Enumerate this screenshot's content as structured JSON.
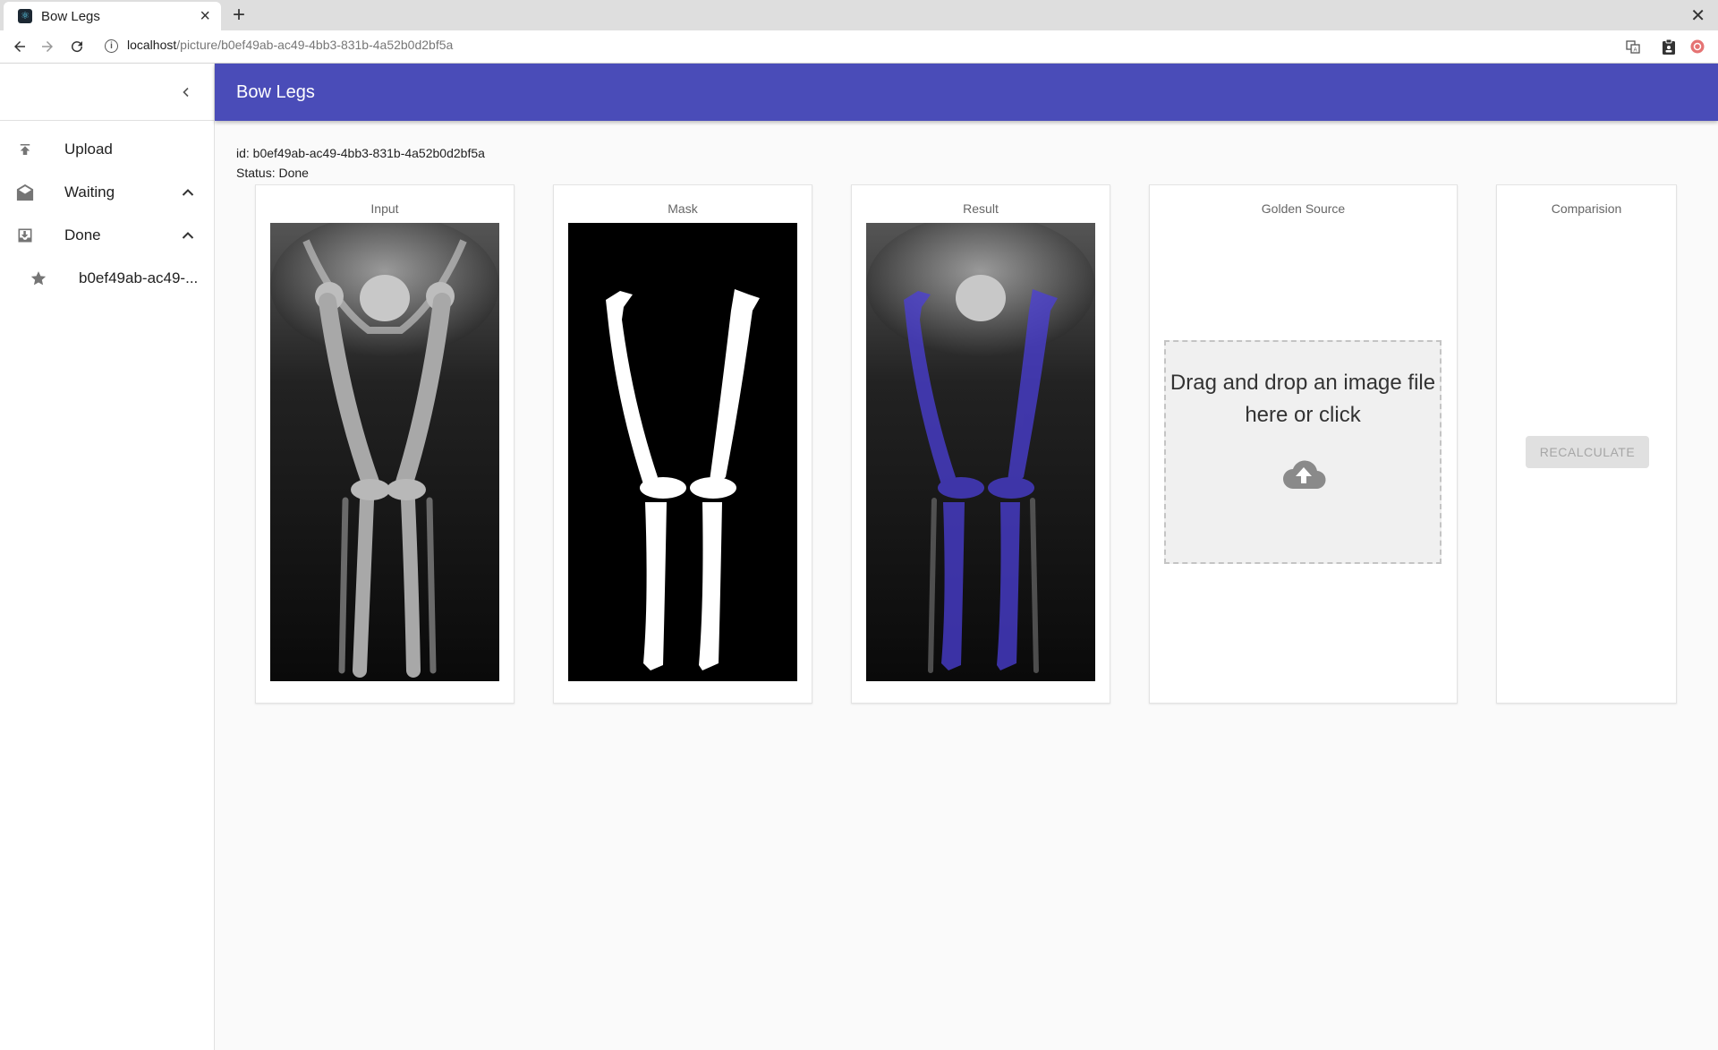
{
  "browser": {
    "tab_title": "Bow Legs",
    "url_host": "localhost",
    "url_path": "/picture/b0ef49ab-ac49-4bb3-831b-4a52b0d2bf5a"
  },
  "sidebar": {
    "items": [
      {
        "label": "Upload",
        "icon": "upload-icon"
      },
      {
        "label": "Waiting",
        "icon": "mail-open-icon",
        "expanded": true
      },
      {
        "label": "Done",
        "icon": "inbox-download-icon",
        "expanded": true
      },
      {
        "label": "b0ef49ab-ac49-...",
        "icon": "star-icon"
      }
    ]
  },
  "appbar": {
    "title": "Bow Legs"
  },
  "details": {
    "id_line": "id: b0ef49ab-ac49-4bb3-831b-4a52b0d2bf5a",
    "status_line": "Status: Done"
  },
  "cards": {
    "input": {
      "title": "Input"
    },
    "mask": {
      "title": "Mask"
    },
    "result": {
      "title": "Result"
    },
    "golden": {
      "title": "Golden Source",
      "dropzone_text": "Drag and drop an image file here or click"
    },
    "comparison": {
      "title": "Comparision",
      "button_label": "RECALCULATE",
      "button_disabled": true
    }
  },
  "colors": {
    "appbar": "#4a4cb8",
    "overlay": "#4b3fd8"
  }
}
